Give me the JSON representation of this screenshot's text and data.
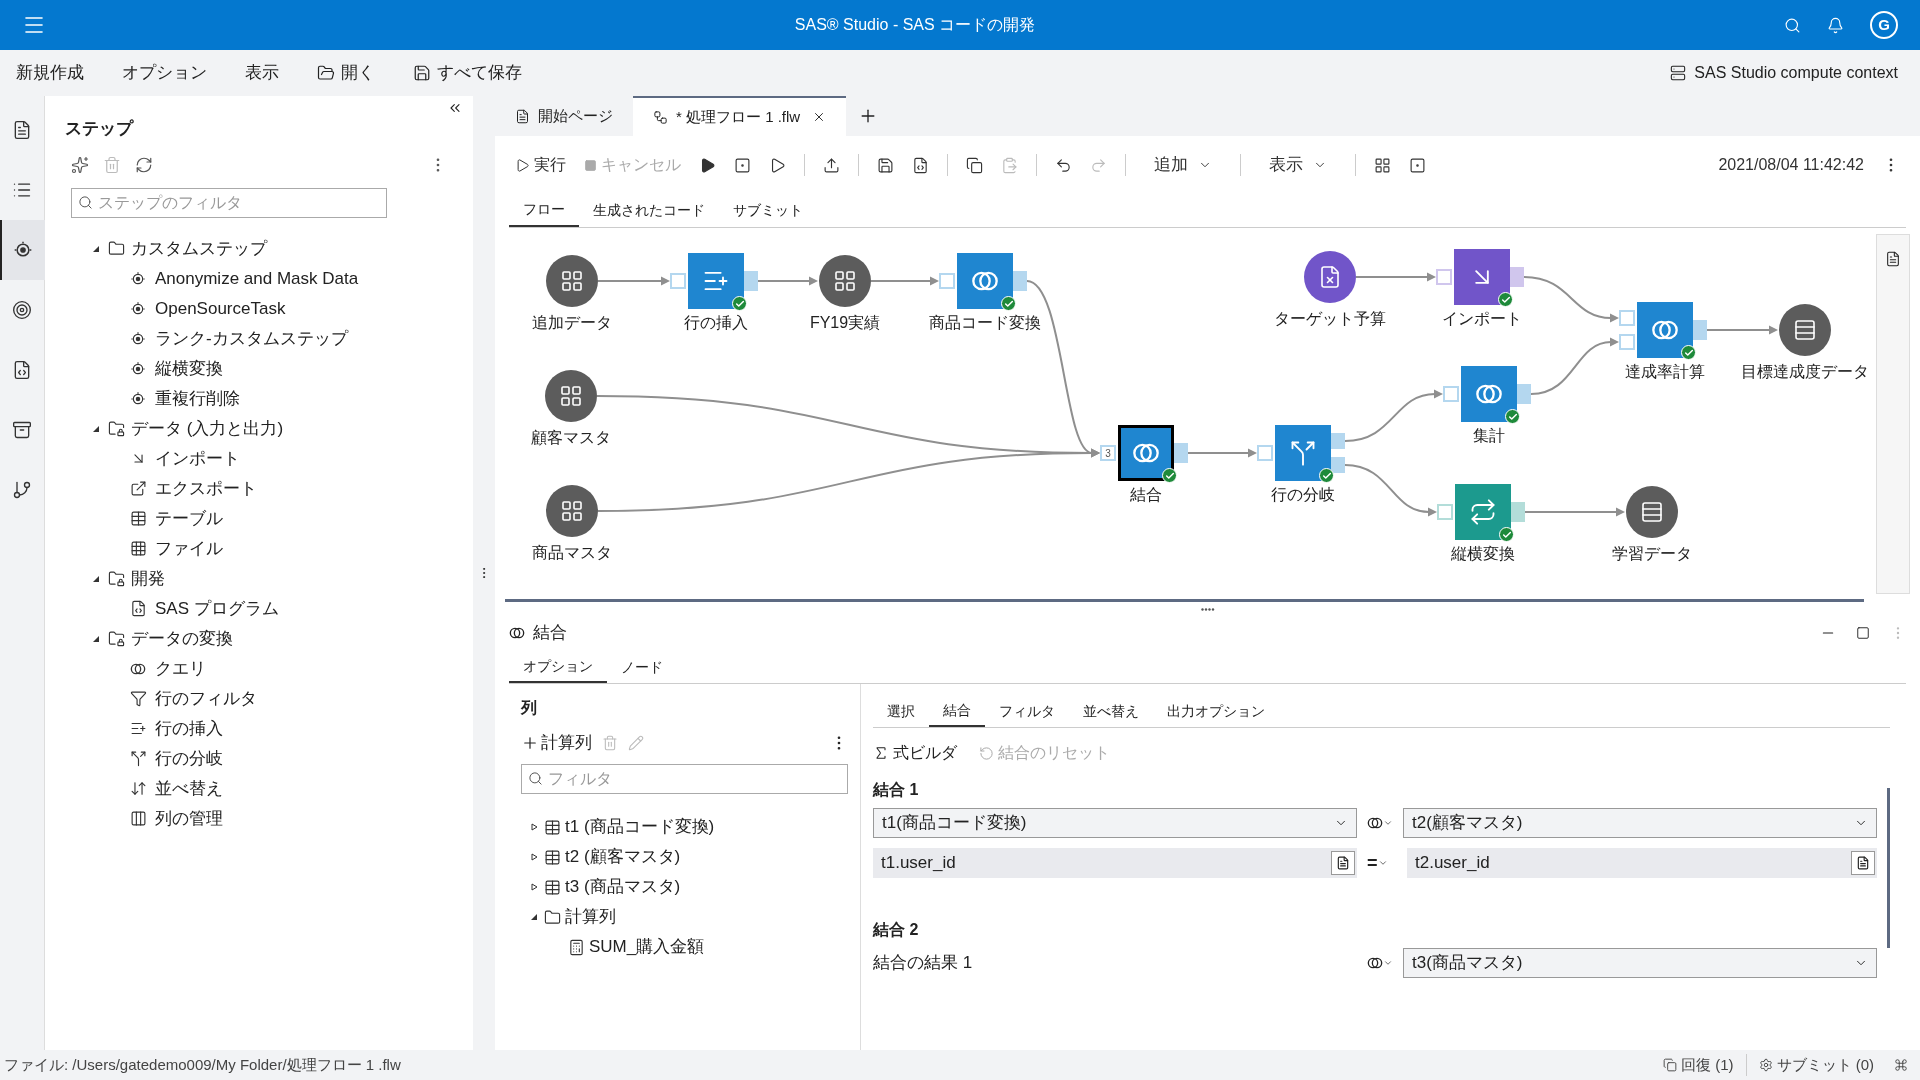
{
  "header": {
    "title": "SAS® Studio - SAS コードの開発",
    "avatar": "G"
  },
  "menu": {
    "items": [
      {
        "label": "新規作成",
        "kind": "text"
      },
      {
        "label": "オプション",
        "kind": "text"
      },
      {
        "label": "表示",
        "kind": "text"
      },
      {
        "label": "開く",
        "kind": "open"
      },
      {
        "label": "すべて保存",
        "kind": "save"
      }
    ],
    "context": "SAS Studio compute context"
  },
  "rail": [
    {
      "kind": "doc",
      "selected": false
    },
    {
      "kind": "list",
      "selected": false
    },
    {
      "kind": "step",
      "selected": true
    },
    {
      "kind": "target",
      "selected": false
    },
    {
      "kind": "snippet",
      "selected": false
    },
    {
      "kind": "library",
      "selected": false
    },
    {
      "kind": "git",
      "selected": false
    }
  ],
  "steps_panel": {
    "title": "ステップ",
    "filter_placeholder": "ステップのフィルタ",
    "tree": [
      {
        "label": "カスタムステップ",
        "kind": "folder",
        "expanded": true,
        "children": [
          {
            "label": "Anonymize and Mask Data",
            "kind": "custom"
          },
          {
            "label": "OpenSourceTask",
            "kind": "custom"
          },
          {
            "label": "ランク-カスタムステップ",
            "kind": "custom"
          },
          {
            "label": "縦横変換",
            "kind": "custom"
          },
          {
            "label": "重複行削除",
            "kind": "custom"
          }
        ]
      },
      {
        "label": "データ (入力と出力)",
        "kind": "locked",
        "expanded": true,
        "children": [
          {
            "label": "インポート",
            "kind": "import"
          },
          {
            "label": "エクスポート",
            "kind": "export"
          },
          {
            "label": "テーブル",
            "kind": "table"
          },
          {
            "label": "ファイル",
            "kind": "file"
          }
        ]
      },
      {
        "label": "開発",
        "kind": "locked",
        "expanded": true,
        "children": [
          {
            "label": "SAS プログラム",
            "kind": "program"
          }
        ]
      },
      {
        "label": "データの変換",
        "kind": "locked",
        "expanded": true,
        "children": [
          {
            "label": "クエリ",
            "kind": "query"
          },
          {
            "label": "行のフィルタ",
            "kind": "filter"
          },
          {
            "label": "行の挿入",
            "kind": "insert"
          },
          {
            "label": "行の分岐",
            "kind": "split"
          },
          {
            "label": "並べ替え",
            "kind": "sort"
          },
          {
            "label": "列の管理",
            "kind": "columns"
          }
        ]
      }
    ]
  },
  "tabs": [
    {
      "label": "開始ページ",
      "kind": "start",
      "selected": false
    },
    {
      "label": "* 処理フロー 1 .flw",
      "kind": "flow",
      "selected": true
    }
  ],
  "toolbar": {
    "run": "実行",
    "cancel": {
      "label": "キャンセル",
      "disabled": true
    },
    "add": "追加",
    "view": "表示",
    "timestamp": "2021/08/04 11:42:42"
  },
  "flow_tabs": [
    {
      "label": "フロー",
      "selected": true
    },
    {
      "label": "生成されたコード",
      "selected": false
    },
    {
      "label": "サブミット",
      "selected": false
    }
  ],
  "flow": {
    "nodes": [
      {
        "label": "追加データ",
        "kind": "table",
        "color": "#5c5c5c",
        "done": false,
        "selected": false
      },
      {
        "label": "行の挿入",
        "kind": "insert",
        "color": "#1f86d0",
        "done": true,
        "selected": false
      },
      {
        "label": "FY19実績",
        "kind": "table",
        "color": "#5c5c5c",
        "done": false,
        "selected": false
      },
      {
        "label": "商品コード変換",
        "kind": "query",
        "color": "#1f86d0",
        "done": true,
        "selected": false
      },
      {
        "label": "顧客マスタ",
        "kind": "table",
        "color": "#5c5c5c",
        "done": false,
        "selected": false
      },
      {
        "label": "商品マスタ",
        "kind": "table",
        "color": "#5c5c5c",
        "done": false,
        "selected": false
      },
      {
        "label": "結合",
        "kind": "query",
        "color": "#1f86d0",
        "done": true,
        "selected": true,
        "input_count": "3"
      },
      {
        "label": "行の分岐",
        "kind": "split",
        "color": "#1f86d0",
        "done": true,
        "selected": false
      },
      {
        "label": "ターゲット予算",
        "kind": "program",
        "color": "#7155c9",
        "done": false,
        "selected": false
      },
      {
        "label": "インポート",
        "kind": "import",
        "color": "#7155c9",
        "done": true,
        "selected": false
      },
      {
        "label": "達成率計算",
        "kind": "query",
        "color": "#1f86d0",
        "done": true,
        "selected": false
      },
      {
        "label": "目標達成度データ",
        "kind": "output",
        "color": "#5c5c5c",
        "done": false,
        "selected": false
      },
      {
        "label": "集計",
        "kind": "query",
        "color": "#1f86d0",
        "done": true,
        "selected": false
      },
      {
        "label": "縦横変換",
        "kind": "transpose",
        "color": "#1c9a8e",
        "done": true,
        "selected": false
      },
      {
        "label": "学習データ",
        "kind": "output",
        "color": "#5c5c5c",
        "done": false,
        "selected": false
      }
    ]
  },
  "details": {
    "title": "結合",
    "tabs": [
      {
        "label": "オプション",
        "selected": true
      },
      {
        "label": "ノード",
        "selected": false
      }
    ],
    "columns": {
      "title": "列",
      "add": "計算列",
      "filter_placeholder": "フィルタ",
      "tree": [
        {
          "label": "t1 (商品コード変換)",
          "kind": "table",
          "expanded": false
        },
        {
          "label": "t2 (顧客マスタ)",
          "kind": "table",
          "expanded": false
        },
        {
          "label": "t3 (商品マスタ)",
          "kind": "table",
          "expanded": false
        },
        {
          "label": "計算列",
          "kind": "folder",
          "expanded": true,
          "children": [
            {
              "label": "SUM_購入金額",
              "kind": "computed"
            }
          ]
        }
      ]
    },
    "subtabs": [
      {
        "label": "選択",
        "selected": false
      },
      {
        "label": "結合",
        "selected": true
      },
      {
        "label": "フィルタ",
        "selected": false
      },
      {
        "label": "並べ替え",
        "selected": false
      },
      {
        "label": "出力オプション",
        "selected": false
      }
    ],
    "builder": "式ビルダ",
    "reset": {
      "label": "結合のリセット",
      "disabled": true
    },
    "join1": {
      "title": "結合 1",
      "left": "t1(商品コード変換)",
      "right": "t2(顧客マスタ)",
      "left_key": "t1.user_id",
      "operator": "=",
      "right_key": "t2.user_id"
    },
    "join2": {
      "title": "結合 2",
      "left": "結合の結果 1",
      "right": "t3(商品マスタ)"
    }
  },
  "status": {
    "file": "ファイル: /Users/gatedemo009/My Folder/処理フロー 1 .flw",
    "recovery": "回復 (1)",
    "submit": "サブミット (0)"
  }
}
